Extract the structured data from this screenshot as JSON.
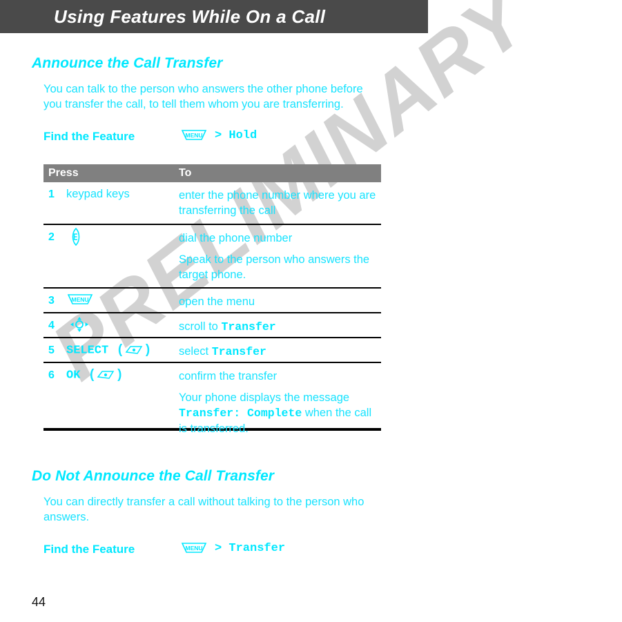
{
  "colors": {
    "accent_cyan": "#00e8ff",
    "body_cyan": "#17e3ff",
    "header_bar_gray": "#4a4a4a",
    "table_header_gray": "#808080",
    "watermark_gray": "#d2d2d2",
    "page_background": "#ffffff",
    "rule_black": "#000000"
  },
  "header": {
    "title": "Using Features While On a Call"
  },
  "watermark": {
    "text": "PRELIMINARY"
  },
  "sections": [
    {
      "heading": "Announce the Call Transfer",
      "body": "You can talk to the person who answers the other phone before you transfer the call, to tell them whom you are transferring.",
      "find_the_feature": {
        "label": "Find the Feature",
        "icon": "menu-key-icon",
        "icon_label": "MENU",
        "path": "> Hold"
      }
    },
    {
      "heading": "Do Not Announce the Call Transfer",
      "body": "You can directly transfer a call without talking to the person who answers.",
      "find_the_feature": {
        "label": "Find the Feature",
        "icon": "menu-key-icon",
        "icon_label": "MENU",
        "path": "> Transfer"
      }
    }
  ],
  "table": {
    "columns": [
      "Press",
      "To"
    ],
    "rows": [
      {
        "num": "1",
        "press_text": "keypad keys",
        "press_icon": null,
        "to": "enter the phone number where you are transferring the call",
        "to_extra": null
      },
      {
        "num": "2",
        "press_text": "",
        "press_icon": "send-key-icon",
        "to": "dial the phone number",
        "to_extra": "Speak to the person who answers the target phone."
      },
      {
        "num": "3",
        "press_text": "",
        "press_icon": "menu-key-icon",
        "press_icon_label": "MENU",
        "to": "open the menu",
        "to_extra": null
      },
      {
        "num": "4",
        "press_text": "",
        "press_icon": "four-way-nav-key-icon",
        "to_prefix": "scroll to ",
        "to_keyword": "Transfer",
        "to": "scroll to Transfer",
        "to_extra": null
      },
      {
        "num": "5",
        "press_text": "SELECT",
        "press_icon": "soft-key-icon",
        "to_prefix": "select ",
        "to_keyword": "Transfer",
        "to": "select Transfer",
        "to_extra": null
      },
      {
        "num": "6",
        "press_text": "OK",
        "press_icon": "soft-key-icon",
        "to": "confirm the transfer",
        "to_extra_prefix": "Your phone displays the message ",
        "to_extra_keyword": "Transfer: Complete",
        "to_extra_suffix": " when the call is transferred."
      }
    ]
  },
  "footer": {
    "page_number": "44"
  }
}
